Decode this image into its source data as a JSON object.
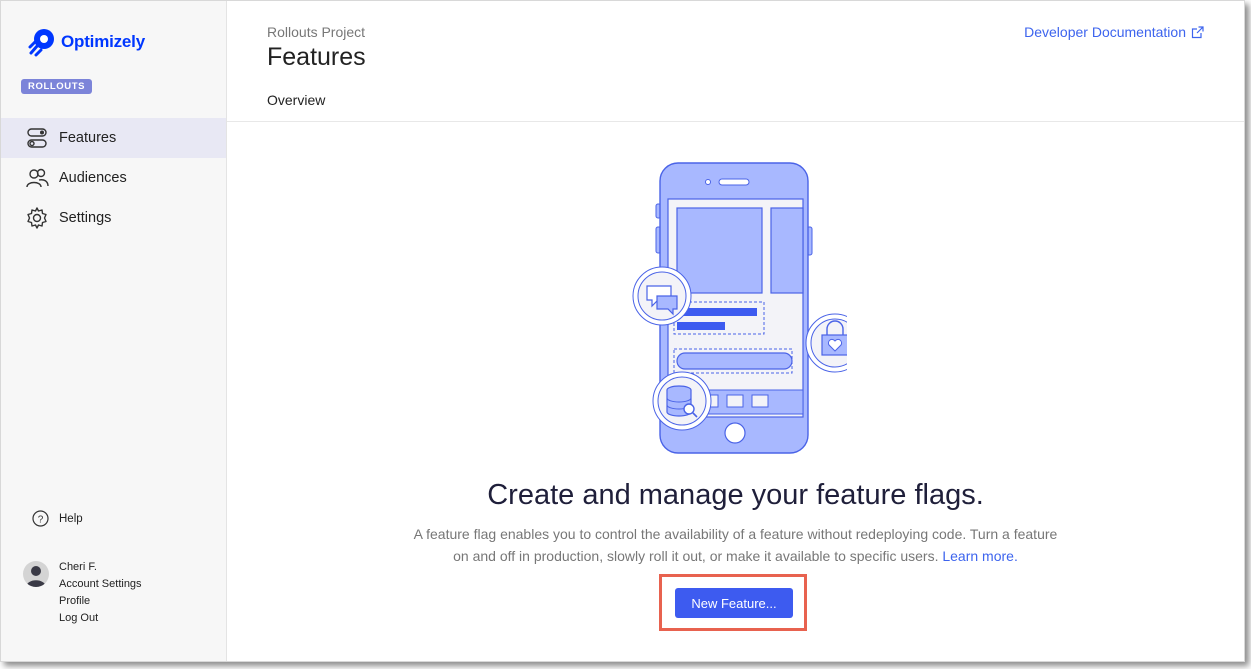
{
  "app": {
    "brand": "Optimizely",
    "product_badge": "ROLLOUTS"
  },
  "sidebar": {
    "items": [
      {
        "label": "Features",
        "icon": "toggle-icon",
        "active": true
      },
      {
        "label": "Audiences",
        "icon": "people-icon",
        "active": false
      },
      {
        "label": "Settings",
        "icon": "gear-icon",
        "active": false
      }
    ],
    "help_label": "Help",
    "account": {
      "name": "Cheri F.",
      "links": [
        "Account Settings",
        "Profile",
        "Log Out"
      ]
    }
  },
  "header": {
    "project": "Rollouts Project",
    "title": "Features",
    "tab": "Overview",
    "dev_doc_link": "Developer Documentation"
  },
  "empty_state": {
    "headline": "Create and manage your feature flags.",
    "description": "A feature flag enables you to control the availability of a feature without redeploying code. Turn a feature on and off in production, slowly roll it out, or make it available to specific users.",
    "learn_more": "Learn more.",
    "button_label": "New Feature..."
  },
  "colors": {
    "brand": "#0037ff",
    "accent": "#3d5bf0",
    "link": "#3d64ee",
    "highlight": "#e8624f",
    "illustration_fill": "#a8b8ff"
  }
}
